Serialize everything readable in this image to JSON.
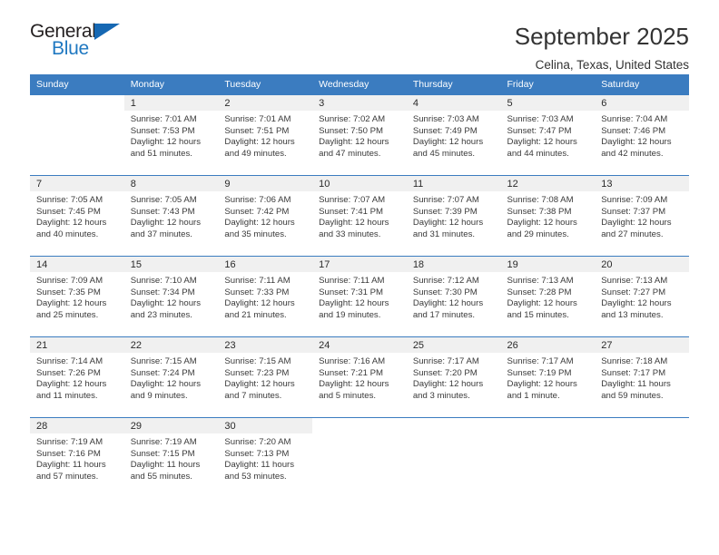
{
  "logo": {
    "word_top": "General",
    "word_bottom": "Blue",
    "accent_color": "#1668b3"
  },
  "header": {
    "title": "September 2025",
    "subtitle": "Celina, Texas, United States"
  },
  "theme": {
    "header_row_bg": "#3b7cc0",
    "daynum_bg": "#f0f0f0",
    "text_color": "#3a3a3a"
  },
  "weekdays": [
    "Sunday",
    "Monday",
    "Tuesday",
    "Wednesday",
    "Thursday",
    "Friday",
    "Saturday"
  ],
  "weeks": [
    [
      {
        "day": "",
        "sunrise": "",
        "sunset": "",
        "daylight": "",
        "blank": true
      },
      {
        "day": "1",
        "sunrise": "Sunrise: 7:01 AM",
        "sunset": "Sunset: 7:53 PM",
        "daylight": "Daylight: 12 hours and 51 minutes."
      },
      {
        "day": "2",
        "sunrise": "Sunrise: 7:01 AM",
        "sunset": "Sunset: 7:51 PM",
        "daylight": "Daylight: 12 hours and 49 minutes."
      },
      {
        "day": "3",
        "sunrise": "Sunrise: 7:02 AM",
        "sunset": "Sunset: 7:50 PM",
        "daylight": "Daylight: 12 hours and 47 minutes."
      },
      {
        "day": "4",
        "sunrise": "Sunrise: 7:03 AM",
        "sunset": "Sunset: 7:49 PM",
        "daylight": "Daylight: 12 hours and 45 minutes."
      },
      {
        "day": "5",
        "sunrise": "Sunrise: 7:03 AM",
        "sunset": "Sunset: 7:47 PM",
        "daylight": "Daylight: 12 hours and 44 minutes."
      },
      {
        "day": "6",
        "sunrise": "Sunrise: 7:04 AM",
        "sunset": "Sunset: 7:46 PM",
        "daylight": "Daylight: 12 hours and 42 minutes."
      }
    ],
    [
      {
        "day": "7",
        "sunrise": "Sunrise: 7:05 AM",
        "sunset": "Sunset: 7:45 PM",
        "daylight": "Daylight: 12 hours and 40 minutes."
      },
      {
        "day": "8",
        "sunrise": "Sunrise: 7:05 AM",
        "sunset": "Sunset: 7:43 PM",
        "daylight": "Daylight: 12 hours and 37 minutes."
      },
      {
        "day": "9",
        "sunrise": "Sunrise: 7:06 AM",
        "sunset": "Sunset: 7:42 PM",
        "daylight": "Daylight: 12 hours and 35 minutes."
      },
      {
        "day": "10",
        "sunrise": "Sunrise: 7:07 AM",
        "sunset": "Sunset: 7:41 PM",
        "daylight": "Daylight: 12 hours and 33 minutes."
      },
      {
        "day": "11",
        "sunrise": "Sunrise: 7:07 AM",
        "sunset": "Sunset: 7:39 PM",
        "daylight": "Daylight: 12 hours and 31 minutes."
      },
      {
        "day": "12",
        "sunrise": "Sunrise: 7:08 AM",
        "sunset": "Sunset: 7:38 PM",
        "daylight": "Daylight: 12 hours and 29 minutes."
      },
      {
        "day": "13",
        "sunrise": "Sunrise: 7:09 AM",
        "sunset": "Sunset: 7:37 PM",
        "daylight": "Daylight: 12 hours and 27 minutes."
      }
    ],
    [
      {
        "day": "14",
        "sunrise": "Sunrise: 7:09 AM",
        "sunset": "Sunset: 7:35 PM",
        "daylight": "Daylight: 12 hours and 25 minutes."
      },
      {
        "day": "15",
        "sunrise": "Sunrise: 7:10 AM",
        "sunset": "Sunset: 7:34 PM",
        "daylight": "Daylight: 12 hours and 23 minutes."
      },
      {
        "day": "16",
        "sunrise": "Sunrise: 7:11 AM",
        "sunset": "Sunset: 7:33 PM",
        "daylight": "Daylight: 12 hours and 21 minutes."
      },
      {
        "day": "17",
        "sunrise": "Sunrise: 7:11 AM",
        "sunset": "Sunset: 7:31 PM",
        "daylight": "Daylight: 12 hours and 19 minutes."
      },
      {
        "day": "18",
        "sunrise": "Sunrise: 7:12 AM",
        "sunset": "Sunset: 7:30 PM",
        "daylight": "Daylight: 12 hours and 17 minutes."
      },
      {
        "day": "19",
        "sunrise": "Sunrise: 7:13 AM",
        "sunset": "Sunset: 7:28 PM",
        "daylight": "Daylight: 12 hours and 15 minutes."
      },
      {
        "day": "20",
        "sunrise": "Sunrise: 7:13 AM",
        "sunset": "Sunset: 7:27 PM",
        "daylight": "Daylight: 12 hours and 13 minutes."
      }
    ],
    [
      {
        "day": "21",
        "sunrise": "Sunrise: 7:14 AM",
        "sunset": "Sunset: 7:26 PM",
        "daylight": "Daylight: 12 hours and 11 minutes."
      },
      {
        "day": "22",
        "sunrise": "Sunrise: 7:15 AM",
        "sunset": "Sunset: 7:24 PM",
        "daylight": "Daylight: 12 hours and 9 minutes."
      },
      {
        "day": "23",
        "sunrise": "Sunrise: 7:15 AM",
        "sunset": "Sunset: 7:23 PM",
        "daylight": "Daylight: 12 hours and 7 minutes."
      },
      {
        "day": "24",
        "sunrise": "Sunrise: 7:16 AM",
        "sunset": "Sunset: 7:21 PM",
        "daylight": "Daylight: 12 hours and 5 minutes."
      },
      {
        "day": "25",
        "sunrise": "Sunrise: 7:17 AM",
        "sunset": "Sunset: 7:20 PM",
        "daylight": "Daylight: 12 hours and 3 minutes."
      },
      {
        "day": "26",
        "sunrise": "Sunrise: 7:17 AM",
        "sunset": "Sunset: 7:19 PM",
        "daylight": "Daylight: 12 hours and 1 minute."
      },
      {
        "day": "27",
        "sunrise": "Sunrise: 7:18 AM",
        "sunset": "Sunset: 7:17 PM",
        "daylight": "Daylight: 11 hours and 59 minutes."
      }
    ],
    [
      {
        "day": "28",
        "sunrise": "Sunrise: 7:19 AM",
        "sunset": "Sunset: 7:16 PM",
        "daylight": "Daylight: 11 hours and 57 minutes."
      },
      {
        "day": "29",
        "sunrise": "Sunrise: 7:19 AM",
        "sunset": "Sunset: 7:15 PM",
        "daylight": "Daylight: 11 hours and 55 minutes."
      },
      {
        "day": "30",
        "sunrise": "Sunrise: 7:20 AM",
        "sunset": "Sunset: 7:13 PM",
        "daylight": "Daylight: 11 hours and 53 minutes."
      },
      {
        "day": "",
        "sunrise": "",
        "sunset": "",
        "daylight": "",
        "blank": true
      },
      {
        "day": "",
        "sunrise": "",
        "sunset": "",
        "daylight": "",
        "blank": true
      },
      {
        "day": "",
        "sunrise": "",
        "sunset": "",
        "daylight": "",
        "blank": true
      },
      {
        "day": "",
        "sunrise": "",
        "sunset": "",
        "daylight": "",
        "blank": true
      }
    ]
  ]
}
